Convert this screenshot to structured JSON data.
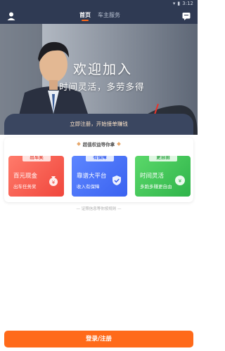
{
  "status_bar": {
    "time": "3:12"
  },
  "header": {
    "tabs": [
      {
        "label": "首页",
        "active": true
      },
      {
        "label": "车主服务",
        "active": false
      }
    ]
  },
  "hero": {
    "title": "欢迎加入",
    "subtitle": "时间灵活，多劳多得",
    "cta_text": "立即注册，开始接单赚钱"
  },
  "benefits": {
    "heading": "超值权益等你拿",
    "tiles": [
      {
        "badge": "出车奖",
        "title": "百元现金",
        "subtitle": "出车任务奖",
        "icon": "money-bag-icon"
      },
      {
        "badge": "有保障",
        "title": "靠谱大平台",
        "subtitle": "收入有保障",
        "icon": "shield-icon"
      },
      {
        "badge": "更自由",
        "title": "时间灵活",
        "subtitle": "多跑多赚更自由",
        "icon": "coin-icon"
      }
    ]
  },
  "rules_text": "— 证照信息等你按规则 —",
  "bottom_button": {
    "label": "登录/注册"
  },
  "colors": {
    "header": "#2f3a53",
    "accent": "#ff6a1a"
  }
}
